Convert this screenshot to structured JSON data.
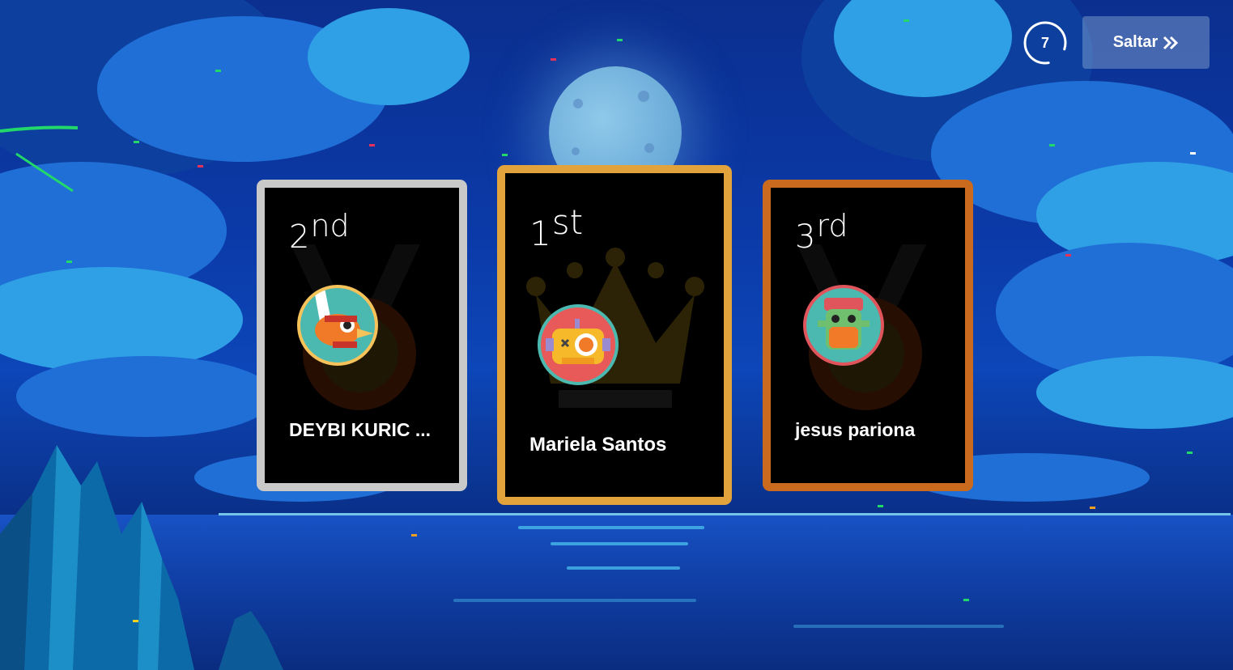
{
  "timer": {
    "value": "7"
  },
  "skip_button": {
    "label": "Saltar",
    "icon": "double-chevron-right-icon"
  },
  "podium": [
    {
      "place": "2",
      "suffix": "nd",
      "name": "DEYBI KURIC ...",
      "frame_color": "#c9c9c9",
      "avatar_icon": "pirate-bird-avatar-icon"
    },
    {
      "place": "1",
      "suffix": "st",
      "name": "Mariela Santos",
      "frame_color": "#e2a23c",
      "avatar_icon": "robot-diver-avatar-icon"
    },
    {
      "place": "3",
      "suffix": "rd",
      "name": "jesus pariona",
      "frame_color": "#c96a1e",
      "avatar_icon": "jar-monster-avatar-icon"
    }
  ]
}
